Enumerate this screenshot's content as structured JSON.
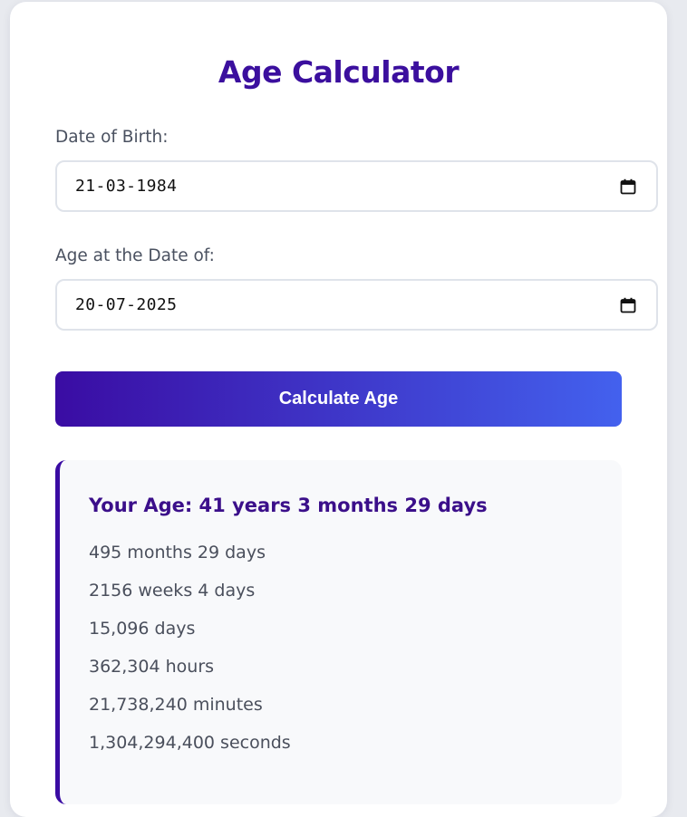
{
  "app": {
    "title": "Age Calculator"
  },
  "form": {
    "birth_label": "Date of Birth:",
    "birth_value": "21-03-1984",
    "target_label": "Age at the Date of:",
    "target_value": "20-07-2025",
    "calendar_icon": "calendar-icon",
    "button_label": "Calculate Age"
  },
  "result": {
    "headline": "Your Age: 41 years 3 months 29 days",
    "lines": [
      "495 months 29 days",
      "2156 weeks 4 days",
      "15,096 days",
      "362,304 hours",
      "21,738,240 minutes",
      "1,304,294,400 seconds"
    ]
  },
  "colors": {
    "title": "#3b0f9e",
    "gradient_start": "#3a0ca3",
    "gradient_end": "#4361ee",
    "result_accent": "#3a0ca3",
    "result_background": "#f8f9fb"
  }
}
